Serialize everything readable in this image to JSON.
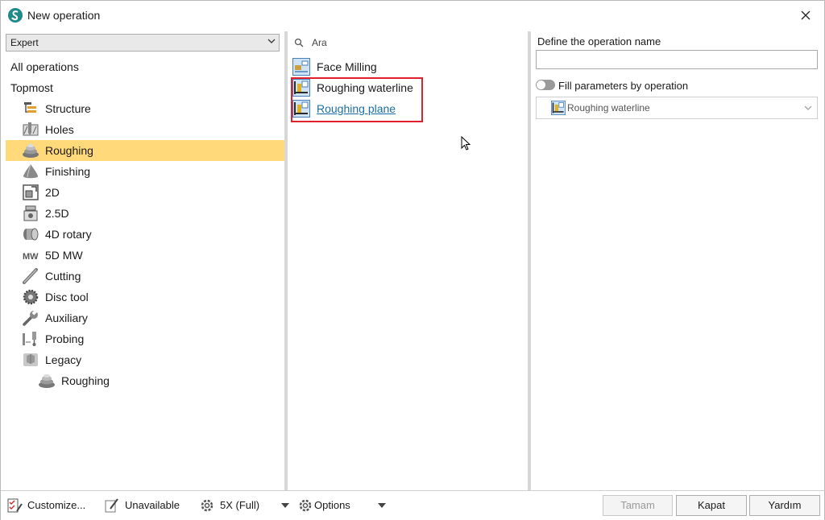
{
  "window": {
    "title": "New operation"
  },
  "left": {
    "filter_value": "Expert",
    "items": [
      {
        "label": "All operations",
        "indent": 0,
        "icon": "none"
      },
      {
        "label": "Topmost",
        "indent": 0,
        "icon": "none"
      },
      {
        "label": "Structure",
        "indent": 1,
        "icon": "structure-icon"
      },
      {
        "label": "Holes",
        "indent": 1,
        "icon": "holes-icon"
      },
      {
        "label": "Roughing",
        "indent": 1,
        "icon": "roughing-icon",
        "selected": true
      },
      {
        "label": "Finishing",
        "indent": 1,
        "icon": "finishing-icon"
      },
      {
        "label": "2D",
        "indent": 1,
        "icon": "2d-icon"
      },
      {
        "label": "2.5D",
        "indent": 1,
        "icon": "2-5d-icon"
      },
      {
        "label": "4D rotary",
        "indent": 1,
        "icon": "4d-rotary-icon"
      },
      {
        "label": "5D MW",
        "indent": 1,
        "icon": "5d-mw-icon"
      },
      {
        "label": "Cutting",
        "indent": 1,
        "icon": "cutting-icon"
      },
      {
        "label": "Disc tool",
        "indent": 1,
        "icon": "disc-tool-icon"
      },
      {
        "label": "Auxiliary",
        "indent": 1,
        "icon": "auxiliary-icon"
      },
      {
        "label": "Probing",
        "indent": 1,
        "icon": "probing-icon"
      },
      {
        "label": "Legacy",
        "indent": 1,
        "icon": "legacy-icon"
      },
      {
        "label": "Roughing",
        "indent": 2,
        "icon": "roughing-icon"
      }
    ]
  },
  "middle": {
    "search_label": "Ara",
    "ops": [
      {
        "label": "Face Milling",
        "icon": "face-milling-icon"
      },
      {
        "label": "Roughing waterline",
        "icon": "roughing-waterline-icon"
      },
      {
        "label": "Roughing plane",
        "icon": "roughing-plane-icon"
      }
    ]
  },
  "right": {
    "name_label": "Define the operation name",
    "name_value": "",
    "fill_toggle_label": "Fill parameters by operation",
    "fill_select_value": "Roughing waterline"
  },
  "bottom": {
    "customize_label": "Customize...",
    "unavailable_label": "Unavailable",
    "mode_label": "5X (Full)",
    "options_label": "Options",
    "ok_label": "Tamam",
    "close_label": "Kapat",
    "help_label": "Yardım"
  },
  "colors": {
    "selection": "#ffd97a",
    "highlight_border": "#e0202a",
    "link": "#1c6fa6",
    "app_icon": "#1f8a8a"
  }
}
